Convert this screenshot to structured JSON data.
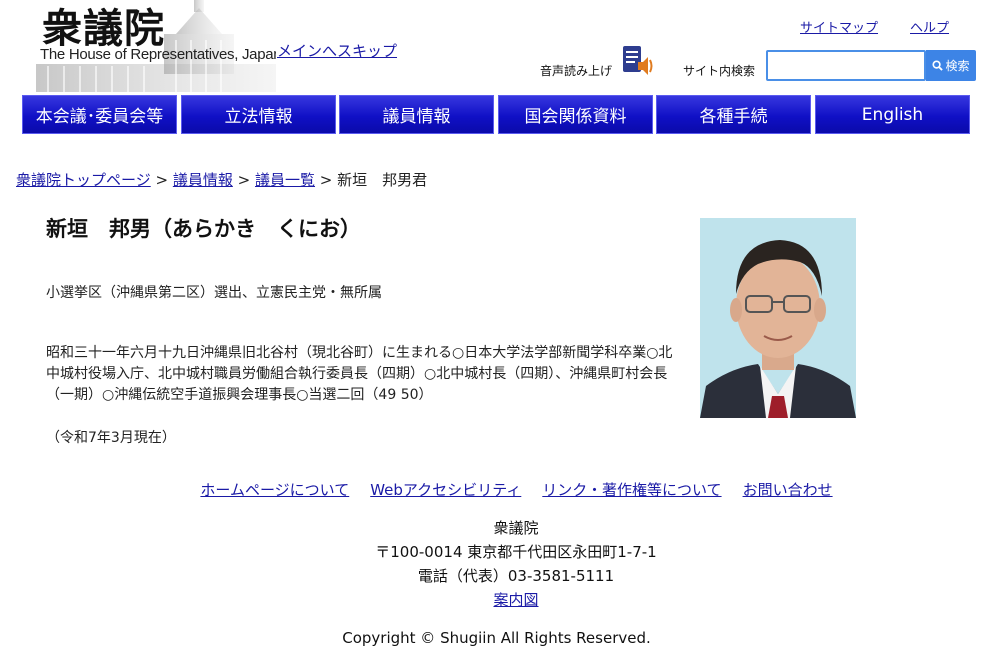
{
  "header": {
    "logo_jp": "衆議院",
    "logo_en": "The House of Representatives, Japan",
    "skip_link": "メインへスキップ",
    "sitemap": "サイトマップ",
    "help": "ヘルプ",
    "read_aloud": "音声読み上げ",
    "search_label": "サイト内検索",
    "search_value": "",
    "search_button": "検索"
  },
  "nav": {
    "items": [
      {
        "label": "本会議･委員会等"
      },
      {
        "label": "立法情報"
      },
      {
        "label": "議員情報"
      },
      {
        "label": "国会関係資料"
      },
      {
        "label": "各種手続"
      },
      {
        "label": "English"
      }
    ]
  },
  "breadcrumb": {
    "items": [
      "衆議院トップページ",
      "議員情報",
      "議員一覧"
    ],
    "separator": ">",
    "current": "新垣　邦男君"
  },
  "profile": {
    "name": "新垣　邦男（あらかき　くにお）",
    "district": "小選挙区（沖縄県第二区）選出、立憲民主党・無所属",
    "bio": "昭和三十一年六月十九日沖縄県旧北谷村（現北谷町）に生まれる○日本大学法学部新聞学科卒業○北中城村役場入庁、北中城村職員労働組合執行委員長（四期）○北中城村長（四期）、沖縄県町村会長（一期）○沖縄伝統空手道振興会理事長○当選二回（49 50）",
    "as_of": "（令和7年3月現在）"
  },
  "footer": {
    "links": [
      "ホームページについて",
      "Webアクセシビリティ",
      "リンク・著作権等について",
      "お問い合わせ"
    ],
    "org": "衆議院",
    "address": "〒100-0014 東京都千代田区永田町1-7-1",
    "phone": "電話（代表）03-3581-5111",
    "map_link": "案内図",
    "copyright": "Copyright © Shugiin All Rights Reserved."
  },
  "colors": {
    "nav_bg": "#1414c8",
    "link": "#1a1aa6",
    "search_border": "#4a8fe7",
    "search_button": "#3d84e6"
  }
}
